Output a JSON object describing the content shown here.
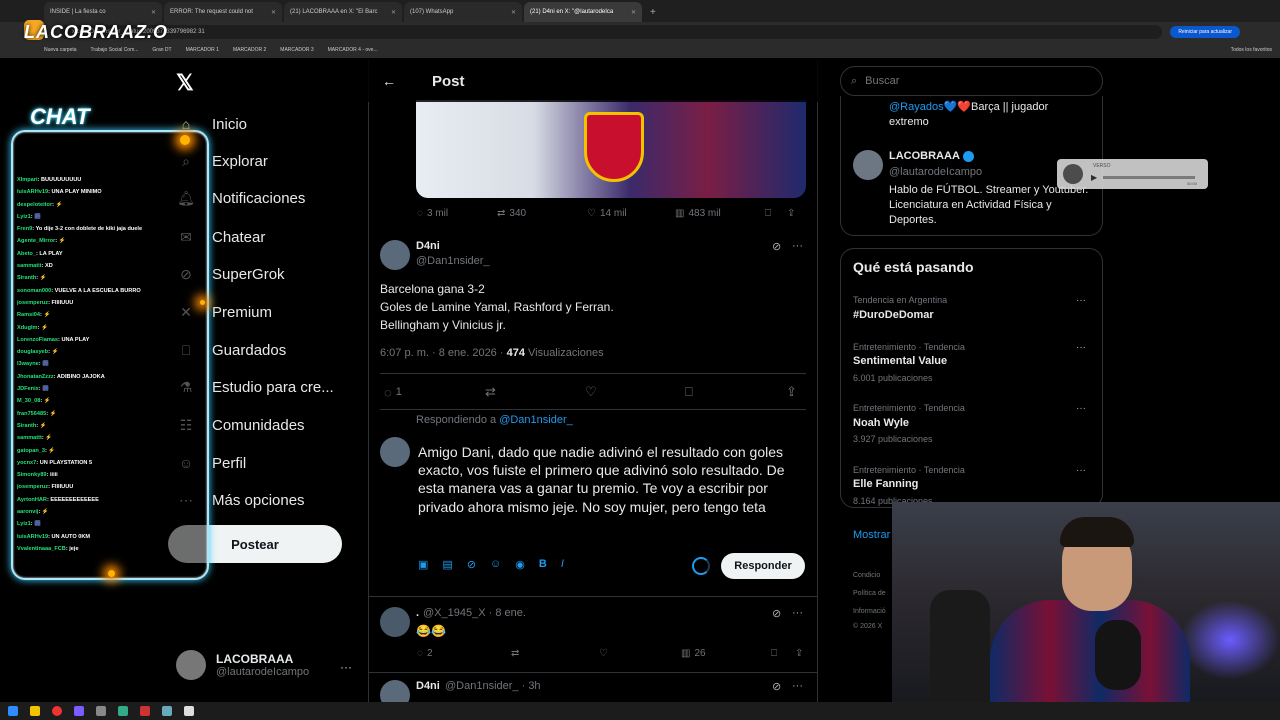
{
  "browser": {
    "tabs": [
      {
        "label": "INSIDE | La fiesta co"
      },
      {
        "label": "ERROR: The request could not"
      },
      {
        "label": "(21) LACOBRAAA en X: \"El Barc"
      },
      {
        "label": "(107) WhatsApp"
      },
      {
        "label": "(21) D4ni en X: \"@lautarodeIca",
        "active": true
      }
    ],
    "url": "x.com/Dan1nsider_/status/2009371339796982 31",
    "update_label": "Reiniciar para actualizar",
    "bookmarks": [
      "Nueva carpeta",
      "Trabajo Social Com...",
      "Gran DT",
      "MARCADOR 1",
      "MARCADOR 2",
      "MARCADOR 3",
      "MARCADOR 4 - ove..."
    ],
    "all_bookmarks": "Todos los favoritos"
  },
  "stream": {
    "logo": "LACOBRAAZ.O",
    "chat_title": "CHAT"
  },
  "chat": [
    {
      "user": "XImpari",
      "msg": "BUUUUUUUUU"
    },
    {
      "user": "luisARHv19",
      "msg": "UNA PLAY MINIMO"
    },
    {
      "user": "despeloteitor",
      "msg": "⚡"
    },
    {
      "user": "Lyiz1",
      "msg": "🎆"
    },
    {
      "user": "Fren9",
      "msg": "Yo dije 3-2 con doblete de kiki jaja duele"
    },
    {
      "user": "Agente_Mirror",
      "msg": "⚡"
    },
    {
      "user": "Abeto_",
      "msg": "LA PLAY"
    },
    {
      "user": "sammatit",
      "msg": "XD"
    },
    {
      "user": "Siranth",
      "msg": "⚡"
    },
    {
      "user": "sonoman000",
      "msg": "VUELVE A LA ESCUELA BURRO"
    },
    {
      "user": "josemperuz",
      "msg": "FIIIIUUU"
    },
    {
      "user": "Ramsi04",
      "msg": "⚡"
    },
    {
      "user": "Xduglm",
      "msg": "⚡"
    },
    {
      "user": "LorenzoFlamas",
      "msg": "UNA PLAY"
    },
    {
      "user": "douglasyeb",
      "msg": "⚡"
    },
    {
      "user": "l3wayne",
      "msg": "🎆"
    },
    {
      "user": "JhonatanZzzz",
      "msg": "ADIBINO JAJOKA"
    },
    {
      "user": "JDFenix",
      "msg": "🎆"
    },
    {
      "user": "M_30_08",
      "msg": "⚡"
    },
    {
      "user": "fran756485",
      "msg": "⚡"
    },
    {
      "user": "Siranth",
      "msg": "⚡"
    },
    {
      "user": "sammattt",
      "msg": "⚡"
    },
    {
      "user": "gatopan_3",
      "msg": "⚡"
    },
    {
      "user": "yocnx7",
      "msg": "UN PLAYSTATION 5"
    },
    {
      "user": "Simonky89",
      "msg": "iiiii"
    },
    {
      "user": "josemperuz",
      "msg": "FIIIIUUU"
    },
    {
      "user": "AyrtonHAR",
      "msg": "EEEEEEEEEEEEE"
    },
    {
      "user": "aaronvij",
      "msg": "⚡"
    },
    {
      "user": "Lyiz1",
      "msg": "🎆"
    },
    {
      "user": "luisARHv19",
      "msg": "UN AUTO 0KM"
    },
    {
      "user": "Vvalentinaaa_FCB",
      "msg": "jeje"
    }
  ],
  "nav": {
    "items": [
      "Inicio",
      "Explorar",
      "Notificaciones",
      "Chatear",
      "SuperGrok",
      "Premium",
      "Guardados",
      "Estudio para cre...",
      "Comunidades",
      "Perfil",
      "Más opciones"
    ],
    "post_label": "Postear",
    "profile_name": "LACOBRAAA",
    "profile_handle": "@lautarodeIcampo",
    "more": "···"
  },
  "header": {
    "title": "Post",
    "back": "←"
  },
  "prev_stats": {
    "replies": "3 mil",
    "retweets": "340",
    "likes": "14 mil",
    "views": "483 mil"
  },
  "tweet": {
    "name": "D4ni",
    "handle": "@Dan1nsider_",
    "lines": [
      "Barcelona gana 3-2",
      "Goles de Lamine Yamal, Rashford y Ferran.",
      "Bellingham y Vinicius jr."
    ],
    "time": "6:07 p. m. · 8 ene. 2026 · ",
    "views_count": "474",
    "views_label": " Visualizaciones",
    "reply_count": "1"
  },
  "reply_box": {
    "replying_prefix": "Respondiendo a ",
    "replying_handle": "@Dan1nsider_",
    "text": "Amigo Dani, dado que nadie adivinó el resultado con goles exacto, vos fuiste el primero que adivinó solo resultado. De esta manera vas a ganar tu premio. Te voy a escribir por privado ahora mismo jeje. No soy mujer, pero tengo teta",
    "button": "Responder"
  },
  "reply1": {
    "name": ".",
    "handle": "@X_1945_X · 8 ene.",
    "text": "😂😂",
    "replies": "2",
    "views": "26"
  },
  "reply2": {
    "name": "D4ni",
    "handle": "@Dan1nsider_ · 3h"
  },
  "right": {
    "search_placeholder": "Buscar",
    "bio_prev": "@Rayados💙❤️Barça || jugador extremo",
    "bio_prev_mention": "@Rayados",
    "bio_prev_rest": "💙❤️Barça || jugador",
    "bio_prev_line2": "extremo",
    "card_name": "LACOBRAAA",
    "card_handle": "@lautarodeIcampo",
    "card_bio": "Hablo de FÚTBOL. Streamer y Youtuber. Licenciatura en Actividad Física y Deportes.",
    "trends_title": "Qué está pasando",
    "trends": [
      {
        "ctx": "Tendencia en Argentina",
        "name": "#DuroDeDomar",
        "count": ""
      },
      {
        "ctx": "Entretenimiento · Tendencia",
        "name": "Sentimental Value",
        "count": "6.001 publicaciones"
      },
      {
        "ctx": "Entretenimiento · Tendencia",
        "name": "Noah Wyle",
        "count": "3.927 publicaciones"
      },
      {
        "ctx": "Entretenimiento · Tendencia",
        "name": "Elle Fanning",
        "count": "8.164 publicaciones"
      }
    ],
    "show_more": "Mostrar",
    "footer": [
      "Condicio",
      "Política de",
      "Informació",
      "© 2026 X"
    ]
  },
  "audio": {
    "label": "VERSO",
    "time": "00:00"
  }
}
